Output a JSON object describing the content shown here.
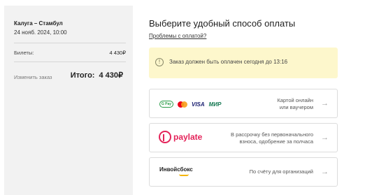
{
  "summary": {
    "route": "Калуга – Стамбул",
    "date": "24 нояб. 2024, 10:00",
    "tickets_label": "Билеты:",
    "tickets_value": "4 430₽",
    "change_order": "Изменить заказ",
    "total_label": "Итого:",
    "total_value": "4 430₽"
  },
  "payment": {
    "title": "Выберите удобный способ оплаты",
    "problem_link": "Проблемы с оплатой?",
    "notice": "Заказ должен быть оплачен сегодня до 13:16",
    "notice_icon": "info-icon",
    "methods": [
      {
        "logos": [
          "G Pay",
          "mastercard",
          "VISA",
          "МИР"
        ],
        "desc_line1": "Картой онлайн",
        "desc_line2": "или ваучером"
      },
      {
        "logo_text": "paylate",
        "desc_line1": "В рассрочку без первоначального",
        "desc_line2": "взноса, одобрение за полчаса"
      },
      {
        "logo_text": "Инвойсбокс",
        "desc_line1": "По счёту для организаций"
      }
    ],
    "arrow": "→"
  }
}
